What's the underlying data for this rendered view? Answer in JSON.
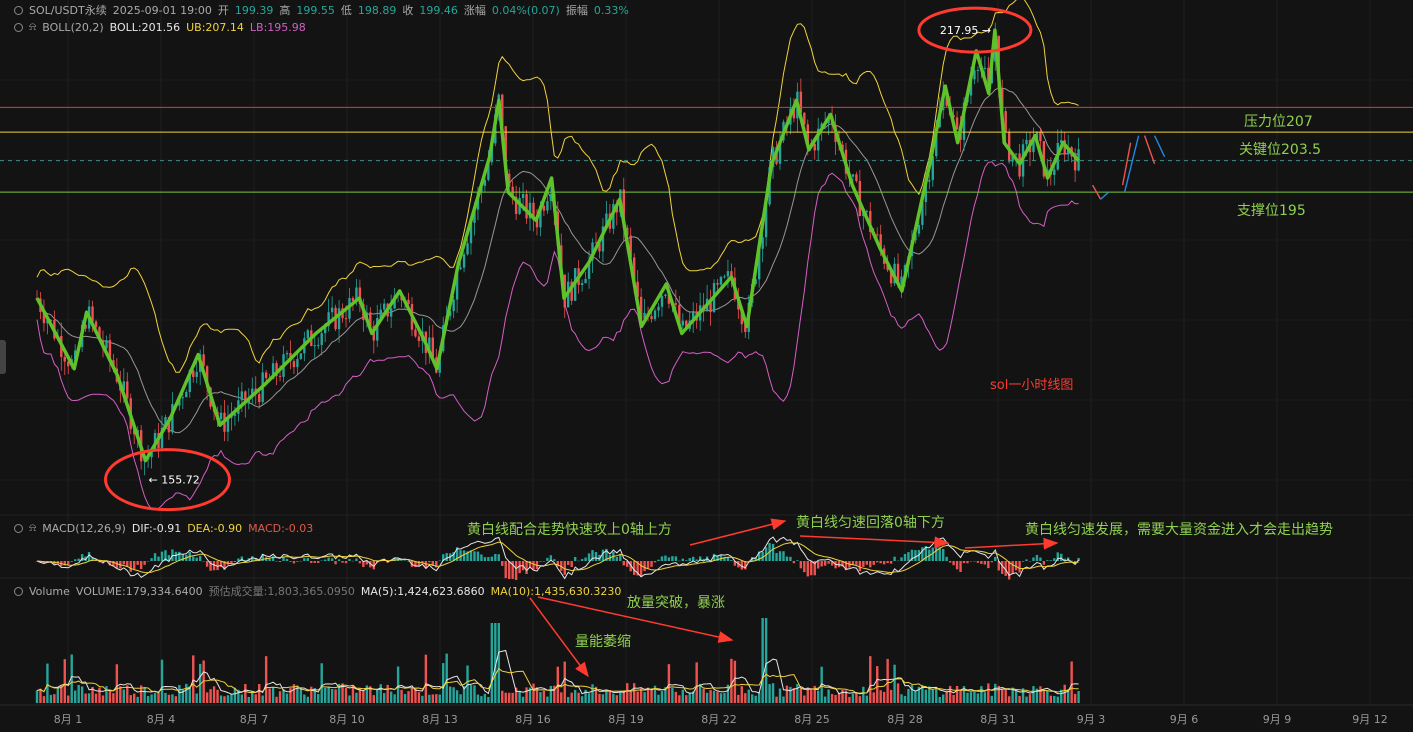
{
  "header": {
    "symbol": "SOL/USDT永续",
    "datetime": "2025-09-01 19:00",
    "open_label": "开",
    "open": "199.39",
    "high_label": "高",
    "high": "199.55",
    "low_label": "低",
    "low": "198.89",
    "close_label": "收",
    "close": "199.46",
    "change_label": "涨幅",
    "change": "0.04%(0.07)",
    "amp_label": "振幅",
    "amp": "0.33%"
  },
  "boll": {
    "label": "BOLL(20,2)",
    "mid": "BOLL:201.56",
    "ub": "UB:207.14",
    "lb": "LB:195.98"
  },
  "macd": {
    "label": "MACD(12,26,9)",
    "dif": "DIF:-0.91",
    "dea": "DEA:-0.90",
    "macd": "MACD:-0.03"
  },
  "volume": {
    "label": "Volume",
    "value": "VOLUME:179,334.6400",
    "est": "预估成交量:1,803,365.0950",
    "ma5": "MA(5):1,424,623.6860",
    "ma10": "MA(10):1,435,630.3230"
  },
  "levels": {
    "resistance": "压力位207",
    "key": "关键位203.5",
    "support": "支撑位195"
  },
  "annotations": {
    "chart_title": "sol一小时线图",
    "high_marker": "217.95",
    "low_marker": "155.72",
    "macd_note1": "黄白线配合走势快速攻上0轴上方",
    "macd_note2": "黄白线匀速回落0轴下方",
    "macd_note3": "黄白线匀速发展，需要大量资金进入才会走出趋势",
    "vol_note1": "放量突破，暴涨",
    "vol_note2": "量能萎缩"
  },
  "colors": {
    "background": "#131313",
    "up": "#26a69a",
    "down": "#ef5350",
    "ub_line": "#f0d23c",
    "lb_line": "#d45fc6",
    "mid_line": "#cfcfcf",
    "trend_line": "#5fc22a",
    "resistance_line": "#e53935",
    "key_line": "#f0d23c",
    "support_line": "#7cc93a",
    "annotation_red": "#ff3b30",
    "annotation_green": "#8fd14f"
  },
  "chart_data": {
    "type": "candlestick",
    "timeframe": "1h",
    "x_tick_labels": [
      "8月 1",
      "8月 4",
      "8月 7",
      "8月 10",
      "8月 13",
      "8月 16",
      "8月 19",
      "8月 22",
      "8月 25",
      "8月 28",
      "8月 31",
      "9月 3",
      "9月 6",
      "9月 9",
      "9月 12"
    ],
    "x_ticks_day": [
      1,
      4,
      7,
      10,
      13,
      16,
      19,
      22,
      25,
      28,
      31,
      34,
      37,
      40,
      43
    ],
    "x_range_day": [
      -0.6,
      45
    ],
    "y_range": [
      150,
      221.5
    ],
    "last_data_day": 33.6,
    "price_path": [
      {
        "day": 0.0,
        "price": 180
      },
      {
        "day": 1.2,
        "price": 170
      },
      {
        "day": 1.6,
        "price": 178
      },
      {
        "day": 2.6,
        "price": 169
      },
      {
        "day": 3.5,
        "price": 157
      },
      {
        "day": 4.3,
        "price": 163
      },
      {
        "day": 5.2,
        "price": 172
      },
      {
        "day": 5.9,
        "price": 162
      },
      {
        "day": 7.4,
        "price": 168
      },
      {
        "day": 9.0,
        "price": 175
      },
      {
        "day": 10.4,
        "price": 180
      },
      {
        "day": 10.8,
        "price": 175
      },
      {
        "day": 11.7,
        "price": 181
      },
      {
        "day": 12.5,
        "price": 174
      },
      {
        "day": 12.9,
        "price": 170
      },
      {
        "day": 13.6,
        "price": 185
      },
      {
        "day": 14.6,
        "price": 200
      },
      {
        "day": 14.9,
        "price": 208
      },
      {
        "day": 15.2,
        "price": 195
      },
      {
        "day": 16.1,
        "price": 191
      },
      {
        "day": 16.6,
        "price": 197
      },
      {
        "day": 17.0,
        "price": 180
      },
      {
        "day": 17.8,
        "price": 185
      },
      {
        "day": 18.8,
        "price": 194
      },
      {
        "day": 19.5,
        "price": 176
      },
      {
        "day": 20.3,
        "price": 182
      },
      {
        "day": 20.8,
        "price": 175
      },
      {
        "day": 22.4,
        "price": 183
      },
      {
        "day": 22.9,
        "price": 176
      },
      {
        "day": 23.7,
        "price": 199
      },
      {
        "day": 24.5,
        "price": 208
      },
      {
        "day": 24.9,
        "price": 201
      },
      {
        "day": 25.6,
        "price": 206
      },
      {
        "day": 26.3,
        "price": 196
      },
      {
        "day": 27.2,
        "price": 187
      },
      {
        "day": 27.9,
        "price": 181
      },
      {
        "day": 28.8,
        "price": 199
      },
      {
        "day": 29.3,
        "price": 210
      },
      {
        "day": 29.7,
        "price": 202
      },
      {
        "day": 30.3,
        "price": 215
      },
      {
        "day": 30.7,
        "price": 209
      },
      {
        "day": 30.9,
        "price": 217.95
      },
      {
        "day": 31.2,
        "price": 202
      },
      {
        "day": 31.7,
        "price": 199
      },
      {
        "day": 32.2,
        "price": 203
      },
      {
        "day": 32.6,
        "price": 197
      },
      {
        "day": 33.1,
        "price": 202
      },
      {
        "day": 33.6,
        "price": 199.46
      }
    ],
    "horizontal_levels": [
      {
        "name": "压力位207",
        "value": 207,
        "color": "#e53935"
      },
      {
        "name": "关键位203.5",
        "value": 203.5,
        "color": "#f0d23c"
      },
      {
        "name": "支撑位195",
        "value": 195,
        "color": "#7cc93a"
      }
    ],
    "dashed_level": 199.46,
    "high": 217.95,
    "low": 155.72,
    "indicators": {
      "boll": {
        "period": 20,
        "k": 2,
        "mid": 201.56,
        "ub": 207.14,
        "lb": 195.98
      },
      "macd": {
        "fast": 12,
        "slow": 26,
        "signal": 9,
        "dif": -0.91,
        "dea": -0.9,
        "macd": -0.03
      },
      "volume": {
        "volume": 179334.64,
        "ma5": 1424623.686,
        "ma10": 1435630.323
      }
    }
  }
}
